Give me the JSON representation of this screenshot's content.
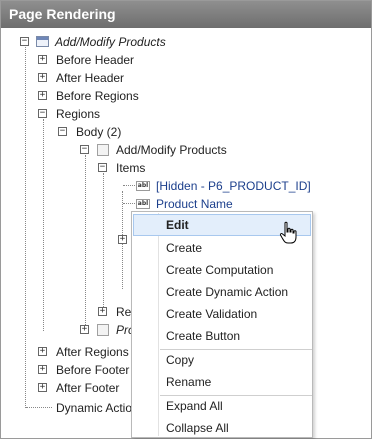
{
  "panel": {
    "title": "Page Rendering"
  },
  "tree": {
    "root": "Add/Modify Products",
    "before_header": "Before Header",
    "after_header": "After Header",
    "before_regions": "Before Regions",
    "regions": "Regions",
    "body": "Body (2)",
    "region_add_modify": "Add/Modify Products",
    "items": "Items",
    "item_hidden": "[Hidden - P6_PRODUCT_ID]",
    "item_product_name": "Product Name",
    "region_partial_re": "Re",
    "region_partial_pro": "Pro",
    "after_regions": "After Regions",
    "before_footer": "Before Footer",
    "after_footer": "After Footer",
    "dynamic_actions": "Dynamic Actio"
  },
  "context_menu": {
    "edit": "Edit",
    "create": "Create",
    "create_computation": "Create Computation",
    "create_dynamic_action": "Create Dynamic Action",
    "create_validation": "Create Validation",
    "create_button": "Create Button",
    "copy": "Copy",
    "rename": "Rename",
    "expand_all": "Expand All",
    "collapse_all": "Collapse All"
  },
  "icons": {
    "toggle": "plus-minus-toggle-icon",
    "region": "region-icon",
    "item": "text-item-icon",
    "cursor": "hand-pointer-icon"
  },
  "colors": {
    "header_bg": "#7e7e7e",
    "menu_highlight": "#e3eefb"
  }
}
